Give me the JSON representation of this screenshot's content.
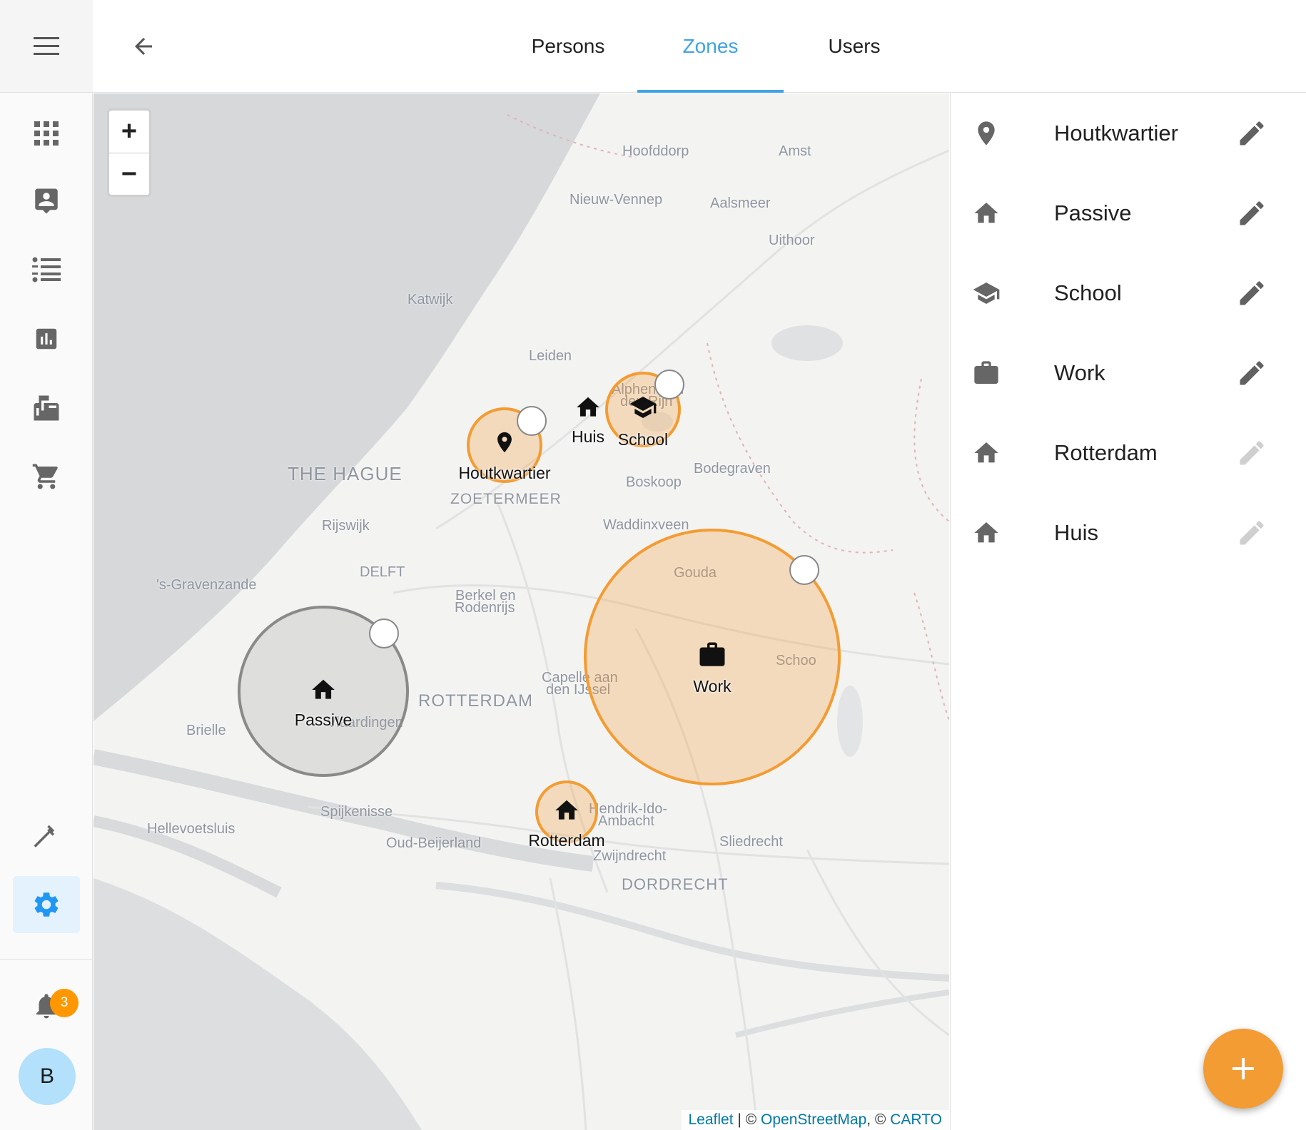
{
  "header": {
    "tabs": [
      {
        "label": "Persons",
        "active": false
      },
      {
        "label": "Zones",
        "active": true
      },
      {
        "label": "Users",
        "active": false
      }
    ]
  },
  "sidebar": {
    "items": [
      {
        "icon": "apps-grid-icon"
      },
      {
        "icon": "contact-card-icon"
      },
      {
        "icon": "format-list-icon"
      },
      {
        "icon": "bar-chart-icon"
      },
      {
        "icon": "mailbox-icon"
      },
      {
        "icon": "cart-icon"
      },
      {
        "icon": "hammer-icon"
      },
      {
        "icon": "settings-gear-icon",
        "active": true
      }
    ],
    "notifications_count": "3",
    "avatar_letter": "B"
  },
  "map": {
    "zoom_in": "+",
    "zoom_out": "−",
    "attribution": {
      "leaflet": "Leaflet",
      "osm": "OpenStreetMap",
      "carto": "CARTO",
      "sep1": " | © ",
      "sep2": ", © "
    },
    "zone_labels": {
      "houtkwartier": "Houtkwartier",
      "huis": "Huis",
      "school": "School",
      "passive": "Passive",
      "work": "Work",
      "rotterdam": "Rotterdam"
    },
    "places": {
      "hoofddorp": "Hoofddorp",
      "amst": "Amst",
      "nieuw_vennep": "Nieuw-Vennep",
      "aalsmeer": "Aalsmeer",
      "uithoorn": "Uithoor",
      "katwijk": "Katwijk",
      "alphen1": "Alphen aan",
      "alphen2": "den Rijn",
      "the_hague": "THE HAGUE",
      "zoetermeer": "ZOETERMEER",
      "bodegraven": "Bodegraven",
      "boskoop": "Boskoop",
      "waddinxveen": "Waddinxveen",
      "rijswijk": "Rijswijk",
      "delft": "DELFT",
      "gravenzande": "'s-Gravenzande",
      "gouda": "Gouda",
      "berkel1": "Berkel en",
      "berkel2": "Rodenrijs",
      "schoo": "Schoo",
      "capelle1": "Capelle aan",
      "capelle2": "den IJssel",
      "rotterdam": "ROTTERDAM",
      "brielle": "Brielle",
      "vlaardingen": "Vlaardingen",
      "spijkenisse": "Spijkenisse",
      "hendrik1": "Hendrik-Ido-",
      "hendrik2": "Ambacht",
      "hellevoetsluis": "Hellevoetsluis",
      "sliedrecht": "Sliedrecht",
      "oud_beijerland": "Oud-Beijerland",
      "zwijndrecht": "Zwijndrecht",
      "dordrecht": "DORDRECHT",
      "leiden": "Leiden"
    }
  },
  "zones": [
    {
      "name": "Houtkwartier",
      "icon": "map-marker-icon",
      "editable": true
    },
    {
      "name": "Passive",
      "icon": "home-icon",
      "editable": true
    },
    {
      "name": "School",
      "icon": "school-icon",
      "editable": true
    },
    {
      "name": "Work",
      "icon": "briefcase-icon",
      "editable": true
    },
    {
      "name": "Rotterdam",
      "icon": "home-icon",
      "editable": false
    },
    {
      "name": "Huis",
      "icon": "home-icon",
      "editable": false
    }
  ],
  "fab": {
    "label": "+"
  },
  "colors": {
    "accent": "#3fa3e6",
    "zone": "#f39c33",
    "passive": "#8a8a8a"
  }
}
